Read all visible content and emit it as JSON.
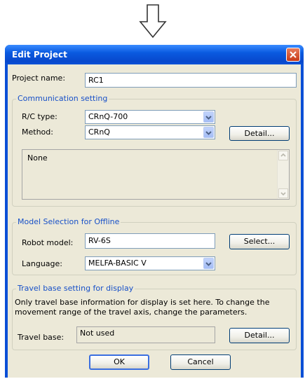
{
  "window": {
    "title": "Edit Project"
  },
  "project": {
    "label": "Project name:",
    "value": "RC1"
  },
  "comm": {
    "title": "Communication setting",
    "rc_type_label": "R/C type:",
    "rc_type_value": "CRnQ-700",
    "method_label": "Method:",
    "method_value": "CRnQ",
    "detail_button": "Detail...",
    "info_text": "None"
  },
  "model": {
    "title": "Model Selection for Offline",
    "robot_label": "Robot model:",
    "robot_value": "RV-6S",
    "select_button": "Select...",
    "language_label": "Language:",
    "language_value": "MELFA-BASIC V"
  },
  "travel": {
    "title": "Travel base setting for display",
    "description_line1": "Only travel base information for display is set here. To change the",
    "description_line2": "movement range of the travel axis, change the parameters.",
    "base_label": "Travel base:",
    "base_value": "Not used",
    "detail_button": "Detail..."
  },
  "buttons": {
    "ok": "OK",
    "cancel": "Cancel"
  },
  "icons": {
    "arrow": "down-arrow-icon",
    "close": "close-icon",
    "dropdown": "chevron-down-icon"
  }
}
